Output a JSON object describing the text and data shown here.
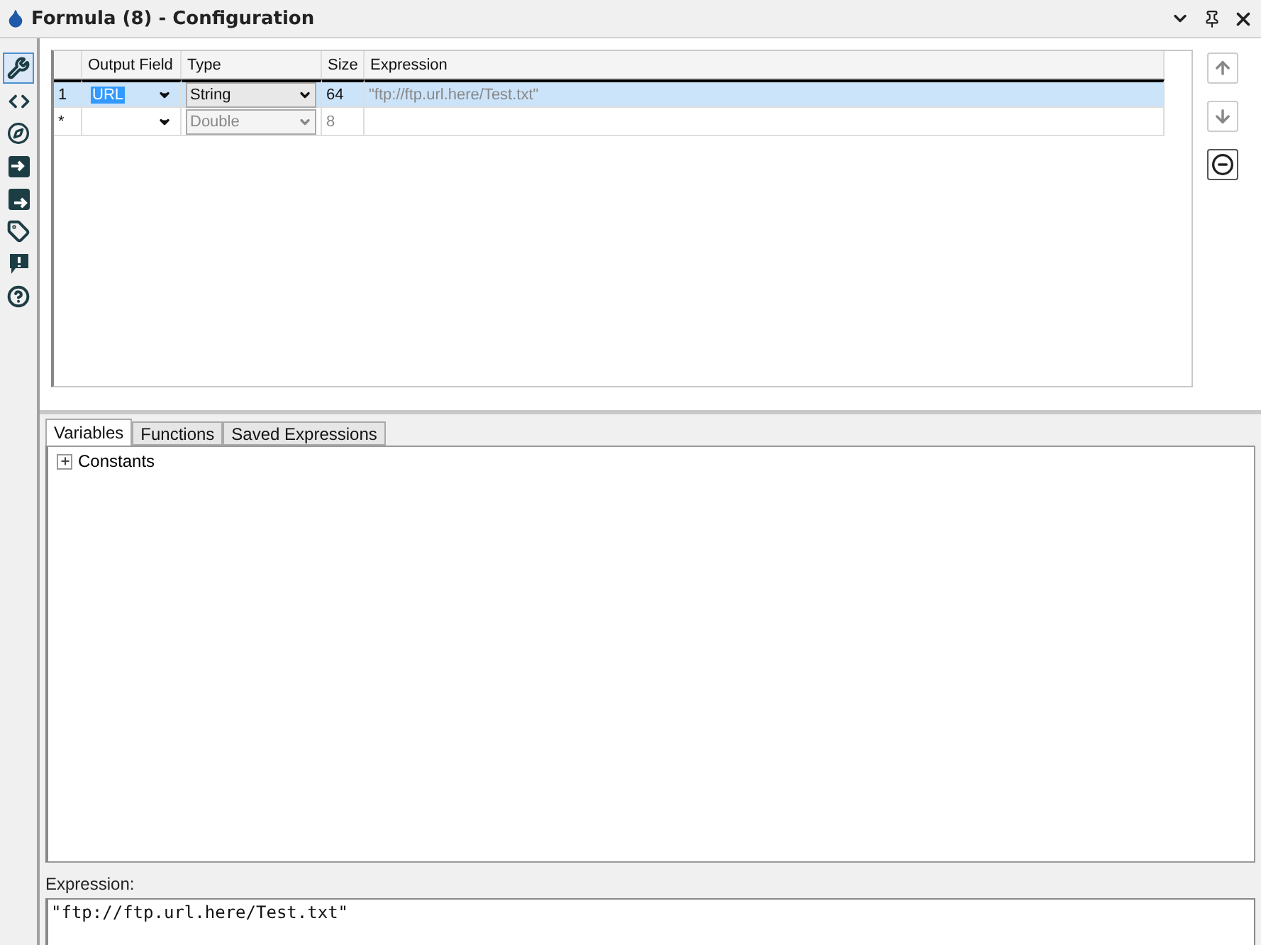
{
  "window": {
    "title": "Formula (8) - Configuration"
  },
  "sidebar": {
    "tools": [
      {
        "kind": "wrench",
        "selected": true
      },
      {
        "kind": "code",
        "selected": false
      },
      {
        "kind": "compass",
        "selected": false
      },
      {
        "kind": "input",
        "selected": false
      },
      {
        "kind": "output",
        "selected": false
      },
      {
        "kind": "tag",
        "selected": false
      },
      {
        "kind": "alert",
        "selected": false
      },
      {
        "kind": "help",
        "selected": false
      }
    ]
  },
  "grid": {
    "columns": [
      "Output Field",
      "Type",
      "Size",
      "Expression"
    ],
    "rows": [
      {
        "kind": "data",
        "header": "1",
        "selected": true,
        "field": "URL",
        "type": "String",
        "size": "64",
        "expression": "\"ftp://ftp.url.here/Test.txt\""
      },
      {
        "kind": "new",
        "header": "*",
        "selected": false,
        "field": "",
        "type": "Double",
        "size": "8",
        "expression": ""
      }
    ]
  },
  "side_buttons": [
    {
      "kind": "up",
      "disabled": true
    },
    {
      "kind": "down",
      "disabled": true
    },
    {
      "kind": "remove",
      "disabled": false
    }
  ],
  "tabs": [
    {
      "label": "Variables",
      "selected": true
    },
    {
      "label": "Functions",
      "selected": false
    },
    {
      "label": "Saved Expressions",
      "selected": false
    }
  ],
  "tree": [
    {
      "label": "Constants",
      "expanded": false
    }
  ],
  "expression": {
    "label": "Expression:",
    "value": "\"ftp://ftp.url.here/Test.txt\""
  }
}
